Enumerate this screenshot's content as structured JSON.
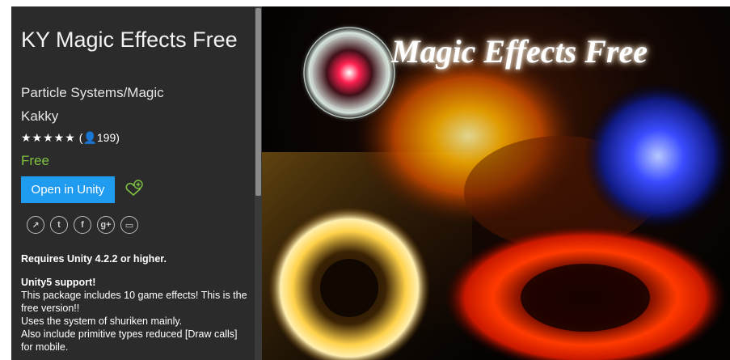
{
  "asset": {
    "title": "KY Magic Effects Free",
    "category": "Particle Systems/Magic",
    "publisher": "Kakky",
    "stars": "★★★★★",
    "rating_count": "199",
    "price": "Free",
    "open_button_label": "Open in Unity"
  },
  "social": {
    "icons": [
      "share-icon",
      "twitter-icon",
      "facebook-icon",
      "google-plus-icon",
      "message-icon"
    ],
    "glyphs": [
      "↗",
      "t",
      "f",
      "g+",
      "▭"
    ]
  },
  "description": {
    "requirement": "Requires Unity 4.2.2 or higher.",
    "heading": "Unity5 support!",
    "lines": [
      "This package includes 10 game effects! This is the free version!!",
      "Uses the system of shuriken mainly.",
      "Also include primitive types reduced [Draw calls] for mobile."
    ]
  },
  "banner": {
    "title": "Magic Effects Free"
  },
  "colors": {
    "sidebar_bg": "#2b2b2b",
    "button_blue": "#1f9bf0",
    "price_green": "#7fc242"
  }
}
